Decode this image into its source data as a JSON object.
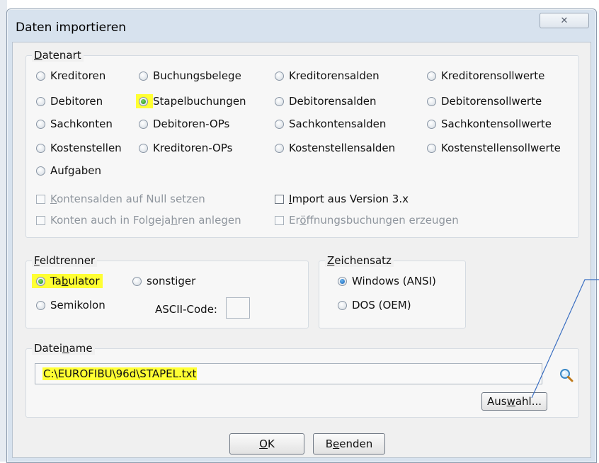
{
  "dialog": {
    "title": "Daten importieren",
    "close_label": "✕"
  },
  "datenart": {
    "title_u": "D",
    "title_rest": "atenart",
    "options": [
      {
        "label": "Kreditoren",
        "checked": false
      },
      {
        "label": "Buchungsbelege",
        "checked": false
      },
      {
        "label": "Kreditorensalden",
        "checked": false
      },
      {
        "label": "Kreditorensollwerte",
        "checked": false
      },
      {
        "label": "Debitoren",
        "checked": false
      },
      {
        "label": "Stapelbuchungen",
        "checked": true
      },
      {
        "label": "Debitorensalden",
        "checked": false
      },
      {
        "label": "Debitorensollwerte",
        "checked": false
      },
      {
        "label": "Sachkonten",
        "checked": false
      },
      {
        "label": "Debitoren-OPs",
        "checked": false
      },
      {
        "label": "Sachkontensalden",
        "checked": false
      },
      {
        "label": "Sachkontensollwerte",
        "checked": false
      },
      {
        "label": "Kostenstellen",
        "checked": false
      },
      {
        "label": "Kreditoren-OPs",
        "checked": false
      },
      {
        "label": "Kostenstellensalden",
        "checked": false
      },
      {
        "label": "Kostenstellensollwerte",
        "checked": false
      },
      {
        "label": "Aufgaben",
        "checked": false
      }
    ],
    "chk_null": {
      "u": "K",
      "rest": "ontensalden auf Null setzen"
    },
    "chk_import": {
      "u": "I",
      "rest": "mport aus Version 3.x"
    },
    "chk_folge": {
      "pre": "Konten auch in Folgeja",
      "u": "h",
      "post": "ren anlegen"
    },
    "chk_eroeff": {
      "pre": "Er",
      "u": "ö",
      "post": "ffnungsbuchungen erzeugen"
    }
  },
  "feldtrenner": {
    "title_u": "F",
    "title_rest": "eldtrenner",
    "tab": {
      "pre": "Ta",
      "u": "b",
      "post": "ulator",
      "checked": true
    },
    "sonstiger": {
      "label": "sonstiger",
      "checked": false
    },
    "semikolon": {
      "label": "Semikolon",
      "checked": false
    },
    "ascii_label": "ASCII-Code:",
    "ascii_value": ""
  },
  "zeichensatz": {
    "title_u": "Z",
    "title_rest": "eichensatz",
    "windows": {
      "label": "Windows (ANSI)",
      "checked": true
    },
    "dos": {
      "label": "DOS (OEM)",
      "checked": false
    }
  },
  "dateiname": {
    "title_pre": "Datei",
    "title_u": "n",
    "title_post": "ame",
    "path": "C:\\EUROFIBU\\96d\\STAPEL.txt",
    "browse_pre": "Aus",
    "browse_u": "w",
    "browse_post": "ahl..."
  },
  "buttons": {
    "ok_u": "O",
    "ok_rest": "K",
    "beenden_pre": "B",
    "beenden_u": "e",
    "beenden_post": "enden"
  },
  "colors": {
    "highlight": "#ffff33",
    "radio_checked": "#1c8f14"
  },
  "icons": {
    "search": "magnifier-icon"
  }
}
